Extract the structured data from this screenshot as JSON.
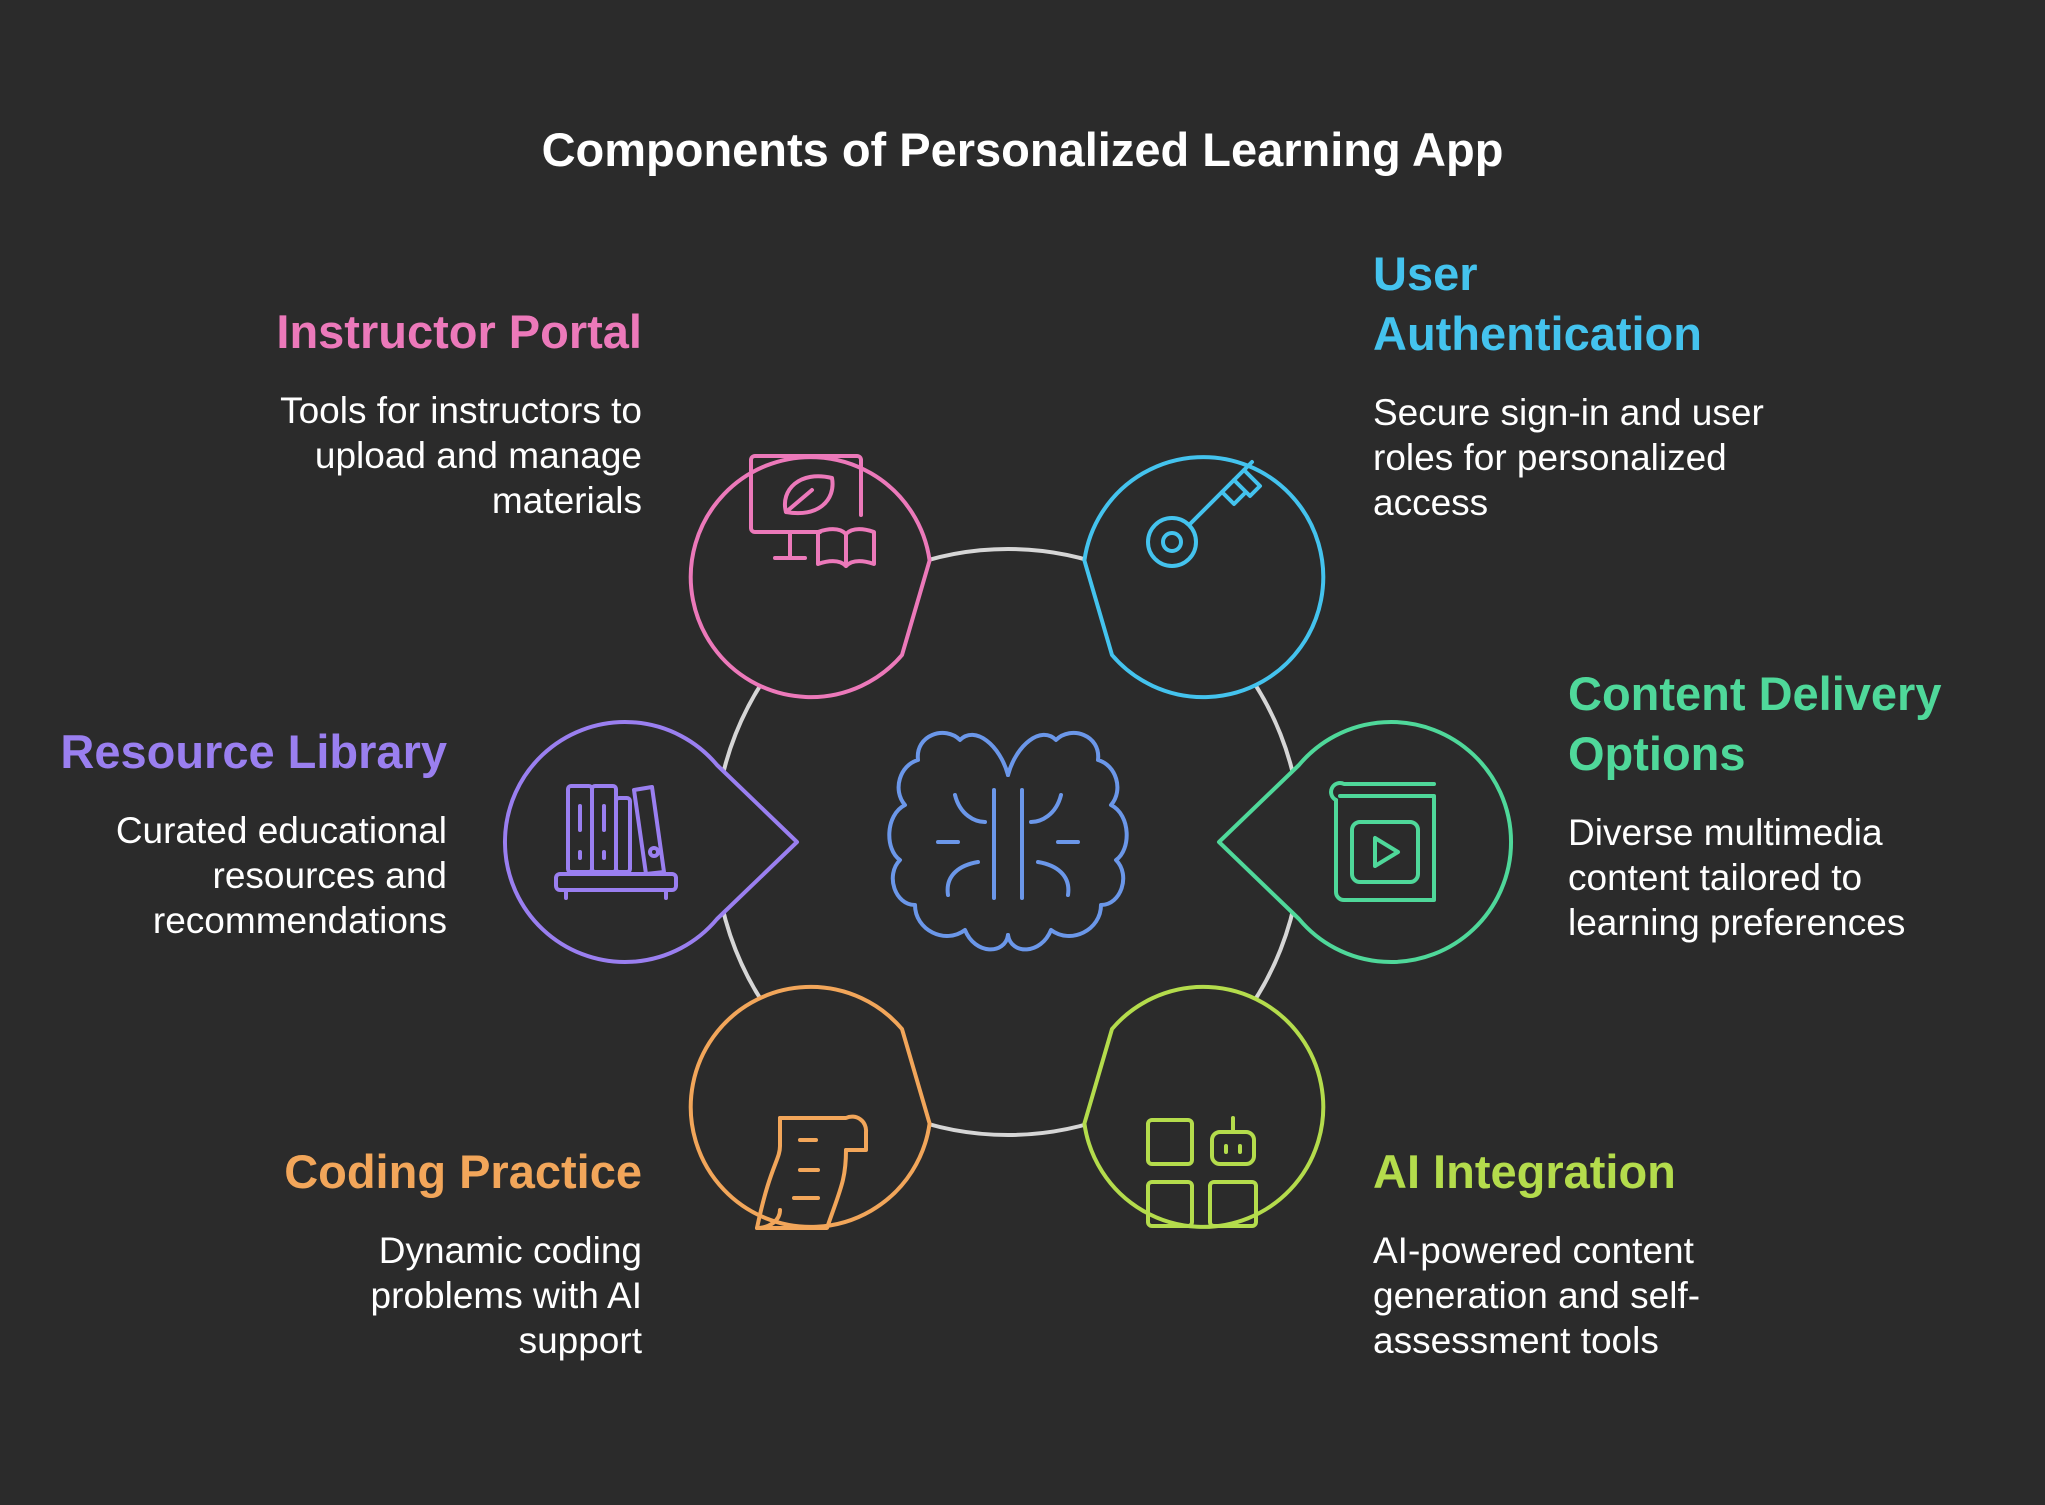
{
  "title": "Components of Personalized Learning App",
  "center": {
    "icon": "brain-icon",
    "color": "#6b97e9"
  },
  "ring_color": "#d6d6d6",
  "components": {
    "instructor_portal": {
      "title": "Instructor Portal",
      "description": "Tools for instructors to upload and manage materials",
      "icon": "monitor-book-icon",
      "color": "#ec79ba"
    },
    "user_authentication": {
      "title": "User Authentication",
      "description": "Secure sign-in and user roles for personalized access",
      "icon": "key-icon",
      "color": "#44c3ee"
    },
    "resource_library": {
      "title": "Resource Library",
      "description": "Curated educational resources and recommendations",
      "icon": "bookshelf-icon",
      "color": "#9a7ff0"
    },
    "content_delivery": {
      "title": "Content Delivery Options",
      "description": "Diverse multimedia content tailored to learning preferences",
      "icon": "video-book-icon",
      "color": "#4fd89a"
    },
    "coding_practice": {
      "title": "Coding Practice",
      "description": "Dynamic coding problems with AI support",
      "icon": "scroll-icon",
      "color": "#f2a65a"
    },
    "ai_integration": {
      "title": "AI Integration",
      "description": "AI-powered content generation and self-assessment tools",
      "icon": "robot-grid-icon",
      "color": "#b4dc4c"
    }
  }
}
